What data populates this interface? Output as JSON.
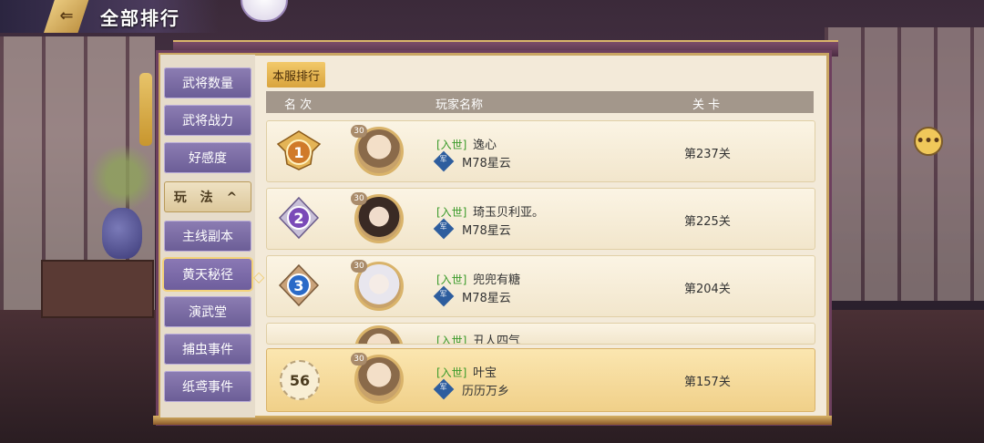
{
  "header": {
    "title": "全部排行",
    "back_glyph": "⇐"
  },
  "sidebar": {
    "items": [
      {
        "label": "武将数量"
      },
      {
        "label": "武将战力"
      },
      {
        "label": "好感度"
      },
      {
        "label": "玩 法 ^"
      },
      {
        "label": "主线副本"
      },
      {
        "label": "黄天秘径"
      },
      {
        "label": "演武堂"
      },
      {
        "label": "捕虫事件"
      },
      {
        "label": "纸鸢事件"
      }
    ],
    "active_index": 5
  },
  "tab": {
    "label": "本服排行"
  },
  "columns": {
    "rank": "名 次",
    "player": "玩家名称",
    "stage": "关 卡"
  },
  "rows": [
    {
      "rank": "1",
      "level": "30",
      "badge": "[入世]",
      "name": "逸心",
      "server_tag": "军",
      "server": "M78星云",
      "stage": "第237关"
    },
    {
      "rank": "2",
      "level": "30",
      "badge": "[入世]",
      "name": "琦玉贝利亚。",
      "server_tag": "军",
      "server": "M78星云",
      "stage": "第225关"
    },
    {
      "rank": "3",
      "level": "30",
      "badge": "[入世]",
      "name": "兜兜有糖",
      "server_tag": "军",
      "server": "M78星云",
      "stage": "第204关"
    }
  ],
  "partial_row": {
    "badge": "[入世]",
    "name": "丑人四气"
  },
  "my_row": {
    "rank": "56",
    "level": "30",
    "badge": "[入世]",
    "name": "叶宝",
    "server_tag": "军",
    "server": "历历万乡",
    "stage": "第157关"
  },
  "colors": {
    "gold": "#d9b36a",
    "purple": "#6b5d96",
    "medal_1": "#d07a2a",
    "medal_2": "#7a4ab8",
    "medal_3": "#2a6ac8"
  }
}
